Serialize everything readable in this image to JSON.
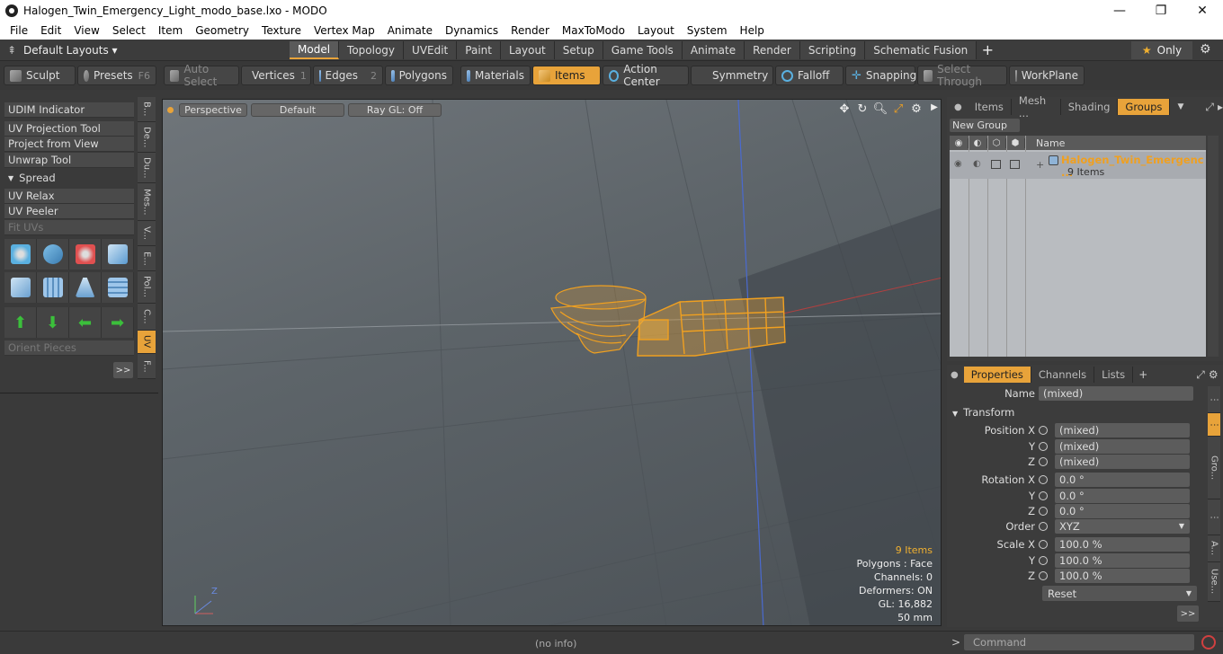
{
  "window": {
    "title": "Halogen_Twin_Emergency_Light_modo_base.lxo - MODO",
    "minimize": "—",
    "maximize": "❐",
    "close": "✕"
  },
  "menu": [
    "File",
    "Edit",
    "View",
    "Select",
    "Item",
    "Geometry",
    "Texture",
    "Vertex Map",
    "Animate",
    "Dynamics",
    "Render",
    "MaxToModo",
    "Layout",
    "System",
    "Help"
  ],
  "layouts": {
    "default_layouts": "Default Layouts ▾",
    "tabs": [
      "Model",
      "Topology",
      "UVEdit",
      "Paint",
      "Layout",
      "Setup",
      "Game Tools",
      "Animate",
      "Render",
      "Scripting",
      "Schematic Fusion"
    ],
    "active_tab": "Model",
    "only_label": "Only",
    "accent": "#e8a33a"
  },
  "toolbar": {
    "sculpt": "Sculpt",
    "presets": "Presets",
    "presets_key": "F6",
    "auto_select": "Auto Select",
    "vertices": "Vertices",
    "vertices_num": "1",
    "edges": "Edges",
    "edges_num": "2",
    "polygons": "Polygons",
    "materials": "Materials",
    "items": "Items",
    "action_center": "Action Center",
    "symmetry": "Symmetry",
    "falloff": "Falloff",
    "snapping": "Snapping",
    "select_through": "Select Through",
    "workplane": "WorkPlane"
  },
  "left_panel": {
    "udim": "UDIM Indicator",
    "uv_projection": "UV Projection Tool",
    "project_from_view": "Project from View",
    "unwrap": "Unwrap Tool",
    "spread": "Spread",
    "uv_relax": "UV Relax",
    "uv_peeler": "UV Peeler",
    "fit_uvs": "Fit UVs",
    "orient_pieces": "Orient Pieces",
    "more": ">>",
    "vtabs": [
      "B...",
      "De...",
      "Du...",
      "Mes...",
      "V...",
      "E...",
      "Pol...",
      "C...",
      "UV",
      "F..."
    ],
    "active_vtab": "UV"
  },
  "viewport": {
    "view": "Perspective",
    "shading": "Default",
    "raygl": "Ray GL: Off",
    "info": {
      "items": "9 Items",
      "polygons": "Polygons : Face",
      "channels": "Channels: 0",
      "deformers": "Deformers: ON",
      "gl": "GL: 16,882",
      "unit": "50 mm"
    },
    "axis_label": "Z"
  },
  "groups_panel": {
    "tabs": [
      "Items",
      "Mesh ...",
      "Shading",
      "Groups"
    ],
    "active_tab": "Groups",
    "new_group": "New Group",
    "col_name": "Name",
    "group_name": "Halogen_Twin_Emergenc ...",
    "group_count": "9 Items"
  },
  "properties": {
    "tabs": [
      "Properties",
      "Channels",
      "Lists"
    ],
    "active_tab": "Properties",
    "name_label": "Name",
    "name_value": "(mixed)",
    "transform_label": "Transform",
    "position_label": "Position X",
    "pos_x": "(mixed)",
    "pos_y": "(mixed)",
    "pos_z": "(mixed)",
    "rotation_label": "Rotation X",
    "rot_x": "0.0 °",
    "rot_y": "0.0 °",
    "rot_z": "0.0 °",
    "order_label": "Order",
    "order_value": "XYZ",
    "scale_label": "Scale X",
    "scale_x": "100.0 %",
    "scale_y": "100.0 %",
    "scale_z": "100.0 %",
    "y_label": "Y",
    "z_label": "Z",
    "reset": "Reset",
    "more": ">>",
    "rvtabs": [
      "⋮",
      "⋮",
      "Gro...",
      "⋮",
      "A...",
      "Use..."
    ]
  },
  "statusbar": {
    "info": "(no info)",
    "command_placeholder": "Command"
  }
}
